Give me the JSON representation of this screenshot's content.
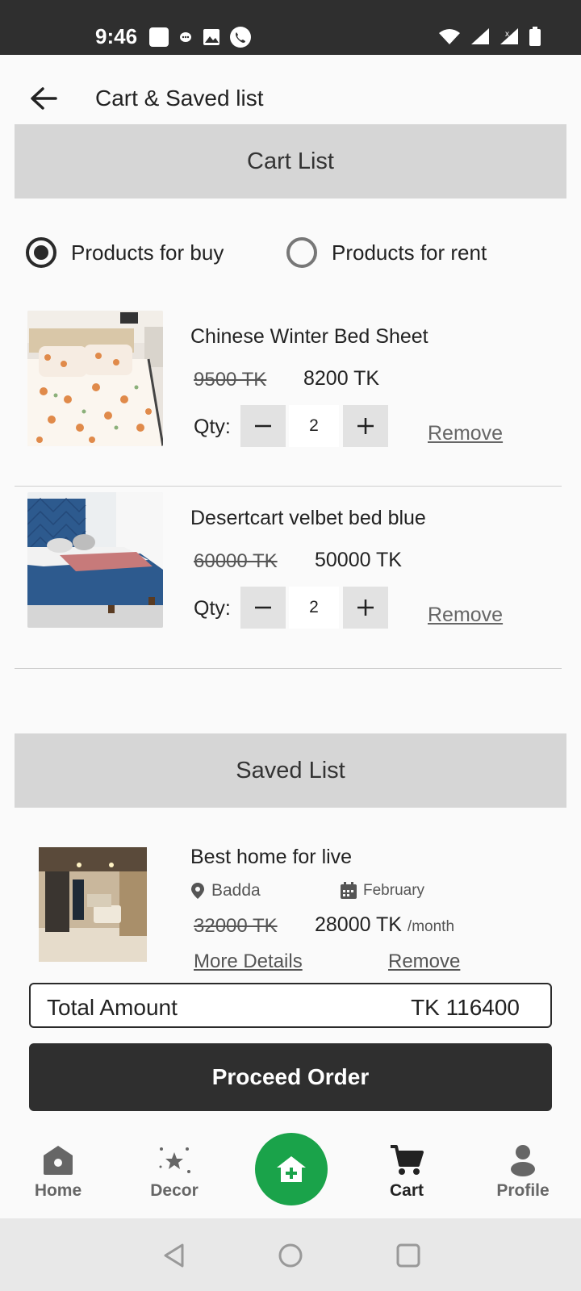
{
  "status_bar": {
    "time": "9:46"
  },
  "header": {
    "title": "Cart & Saved list"
  },
  "cart_section": {
    "title": "Cart List"
  },
  "filter": {
    "options": [
      {
        "label": "Products for buy",
        "selected": true
      },
      {
        "label": "Products for rent",
        "selected": false
      }
    ]
  },
  "cart_items": [
    {
      "name": "Chinese Winter Bed Sheet",
      "old_price": "9500 TK",
      "new_price": "8200 TK",
      "qty_label": "Qty:",
      "qty": "2",
      "remove_label": "Remove"
    },
    {
      "name": "Desertcart velbet bed blue",
      "old_price": "60000 TK",
      "new_price": "50000 TK",
      "qty_label": "Qty:",
      "qty": "2",
      "remove_label": "Remove"
    }
  ],
  "saved_section": {
    "title": "Saved List"
  },
  "saved_items": [
    {
      "name": "Best home for live",
      "location": "Badda",
      "date": "February",
      "old_price": "32000 TK",
      "new_price": "28000 TK",
      "unit": "/month",
      "details_label": "More Details",
      "remove_label": "Remove"
    }
  ],
  "total": {
    "label": "Total Amount",
    "value": "TK 116400"
  },
  "proceed": {
    "label": "Proceed Order"
  },
  "bottom_nav": {
    "items": [
      {
        "label": "Home",
        "icon": "home-icon"
      },
      {
        "label": "Decor",
        "icon": "decor-icon"
      },
      {
        "label": "",
        "icon": "add-home-icon"
      },
      {
        "label": "Cart",
        "icon": "cart-icon",
        "active": true
      },
      {
        "label": "Profile",
        "icon": "profile-icon"
      }
    ]
  },
  "colors": {
    "fab": "#1aa34a",
    "dark": "#2f2f2f",
    "section_bar": "#d6d6d6"
  }
}
